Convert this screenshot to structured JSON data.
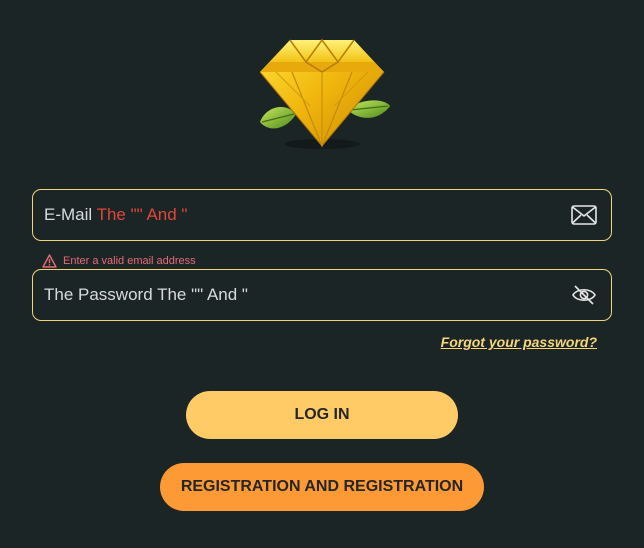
{
  "logo": {
    "icon": "diamond-logo-icon"
  },
  "email_field": {
    "label": "E-Mail",
    "value": "The \"\" And \"",
    "icon": "envelope-icon"
  },
  "email_error": {
    "icon": "warning-icon",
    "message": "Enter a valid email address"
  },
  "password_field": {
    "placeholder": "The Password The \"\" And \"",
    "icon": "eye-off-icon"
  },
  "links": {
    "forgot_password": "Forgot your password?"
  },
  "buttons": {
    "login": "LOG IN",
    "register": "REGISTRATION AND REGISTRATION"
  },
  "colors": {
    "background": "#1c2526",
    "field_border": "#f2d37a",
    "error_text": "#e36c78",
    "email_value": "#e0453a",
    "login_button": "#fecb67",
    "register_button": "#fd9a36",
    "link": "#f5d67a"
  }
}
